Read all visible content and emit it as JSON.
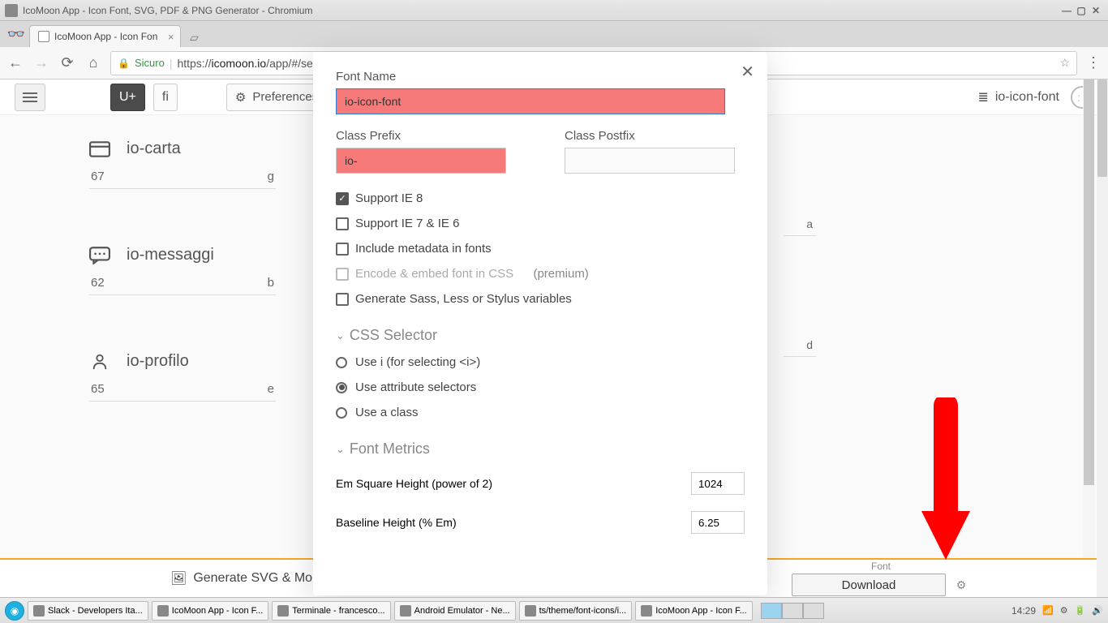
{
  "os": {
    "title": "IcoMoon App - Icon Font, SVG, PDF & PNG Generator - Chromium"
  },
  "tab": {
    "title": "IcoMoon App - Icon Fon"
  },
  "addr": {
    "secure_label": "Sicuro",
    "url_scheme": "https://",
    "url_host": "icomoon.io",
    "url_path": "/app/#/select/font"
  },
  "toolbar": {
    "u_btn": "U+",
    "fi_btn": "fi",
    "preferences": "Preferences",
    "project_name": "io-icon-font"
  },
  "icons": [
    {
      "name": "io-carta",
      "code": "67",
      "char": "g"
    },
    {
      "name": "io-messaggi",
      "code": "62",
      "char": "b"
    },
    {
      "name": "io-profilo",
      "code": "65",
      "char": "e"
    }
  ],
  "right_chars": [
    "a",
    "d"
  ],
  "bottom": {
    "gen_svg": "Generate SVG & More",
    "font_label": "Font",
    "download": "Download"
  },
  "modal": {
    "font_name_label": "Font Name",
    "font_name_value": "io-icon-font",
    "class_prefix_label": "Class Prefix",
    "class_prefix_value": "io-",
    "class_postfix_label": "Class Postfix",
    "class_postfix_value": "",
    "chk_ie8": "Support IE 8",
    "chk_ie76": "Support IE 7 & IE 6",
    "chk_meta": "Include metadata in fonts",
    "chk_embed": "Encode & embed font in CSS",
    "chk_embed_note": "(premium)",
    "chk_vars": "Generate Sass, Less or Stylus variables",
    "css_selector": "CSS Selector",
    "rad_i": "Use i (for selecting <i>)",
    "rad_attr": "Use attribute selectors",
    "rad_class": "Use a class",
    "font_metrics": "Font Metrics",
    "em_height_label": "Em Square Height (power of 2)",
    "em_height_value": "1024",
    "baseline_label": "Baseline Height (% Em)",
    "baseline_value": "6.25"
  },
  "taskbar": {
    "items": [
      "Slack - Developers Ita...",
      "IcoMoon App - Icon F...",
      "Terminale - francesco...",
      "Android Emulator - Ne...",
      "ts/theme/font-icons/i...",
      "IcoMoon App - Icon F..."
    ],
    "clock": "14:29"
  }
}
